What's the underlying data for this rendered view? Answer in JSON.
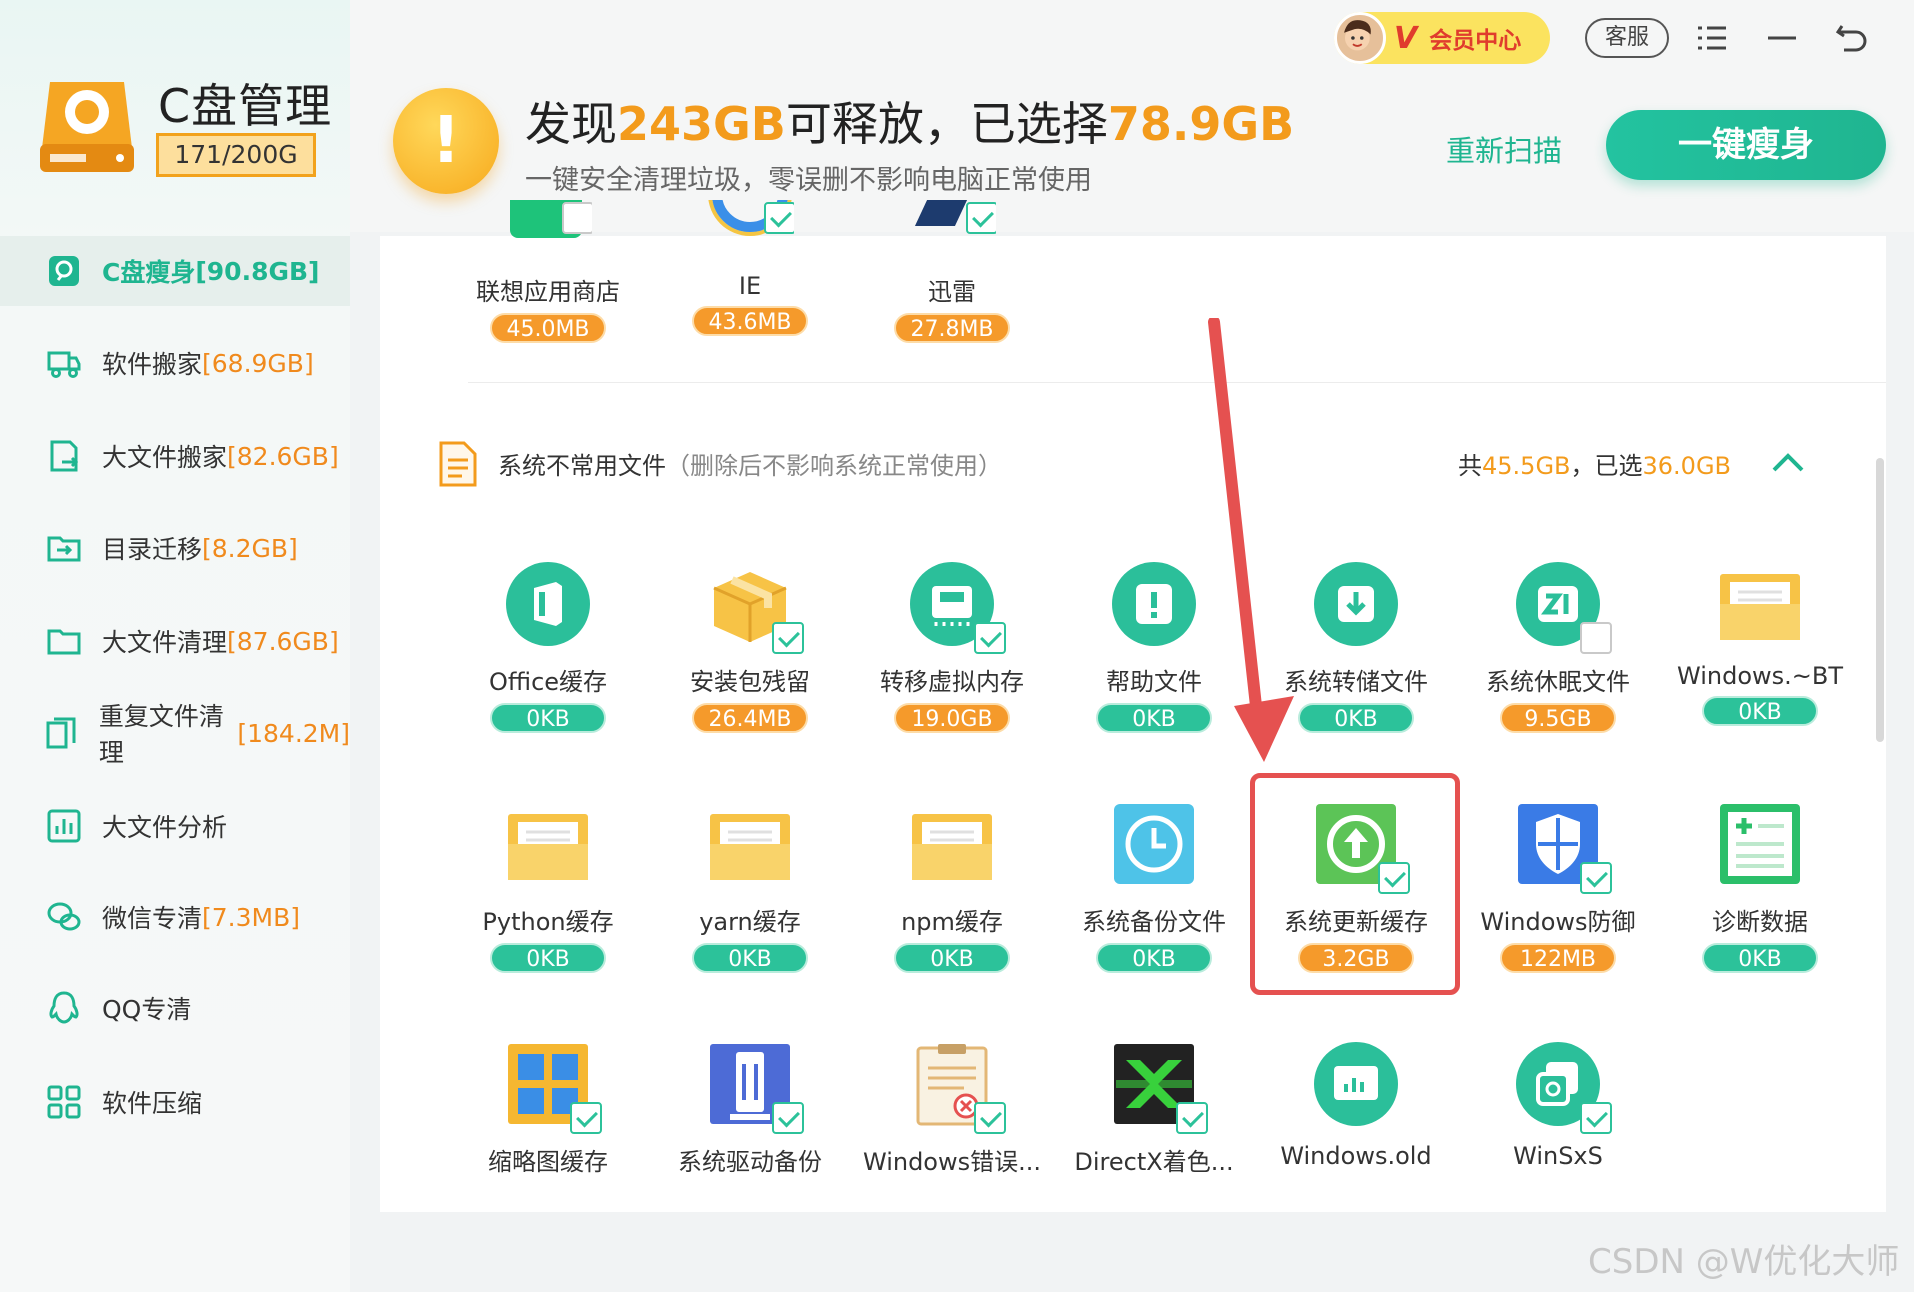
{
  "app": {
    "name": "C盘管理",
    "disk_usage": "171/200G"
  },
  "sidebar": {
    "items": [
      {
        "label": "C盘瘦身",
        "size": "[90.8GB]",
        "icon": "slim-icon",
        "active": true
      },
      {
        "label": "软件搬家",
        "size": "[68.9GB]",
        "icon": "truck-icon"
      },
      {
        "label": "大文件搬家",
        "size": "[82.6GB]",
        "icon": "file-move-icon"
      },
      {
        "label": "目录迁移",
        "size": "[8.2GB]",
        "icon": "folder-move-icon"
      },
      {
        "label": "大文件清理",
        "size": "[87.6GB]",
        "icon": "folder-icon"
      },
      {
        "label": "重复文件清理",
        "size": "[184.2M]",
        "icon": "duplicate-icon"
      },
      {
        "label": "大文件分析",
        "size": "",
        "icon": "chart-icon"
      },
      {
        "label": "微信专清",
        "size": "[7.3MB]",
        "icon": "wechat-icon"
      },
      {
        "label": "QQ专清",
        "size": "",
        "icon": "qq-icon"
      },
      {
        "label": "软件压缩",
        "size": "",
        "icon": "compress-icon"
      }
    ]
  },
  "header": {
    "headline_pre": "发现",
    "found": "243GB",
    "headline_mid": "可释放，已选择",
    "selected": "78.9GB",
    "subline": "一键安全清理垃圾，零误删不影响电脑正常使用",
    "rescan": "重新扫描",
    "slim_button": "一键瘦身",
    "vip_badge": "V",
    "vip_label": "会员中心",
    "support": "客服"
  },
  "top_row": [
    {
      "name": "联想应用商店",
      "size": "45.0MB",
      "checked": false
    },
    {
      "name": "IE",
      "size": "43.6MB",
      "checked": true
    },
    {
      "name": "迅雷",
      "size": "27.8MB",
      "checked": true
    }
  ],
  "section": {
    "title": "系统不常用文件",
    "hint": "（删除后不影响系统正常使用）",
    "total_label": "共",
    "total": "45.5GB",
    "sep": "，",
    "selected_label": "已选",
    "selected": "36.0GB"
  },
  "items": [
    {
      "name": "Office缓存",
      "size": "0KB",
      "icon": "office-icon",
      "checked": false
    },
    {
      "name": "安装包残留",
      "size": "26.4MB",
      "icon": "package-icon",
      "checked": true
    },
    {
      "name": "转移虚拟内存",
      "size": "19.0GB",
      "icon": "memory-icon",
      "checked": true
    },
    {
      "name": "帮助文件",
      "size": "0KB",
      "icon": "help-icon",
      "checked": false
    },
    {
      "name": "系统转储文件",
      "size": "0KB",
      "icon": "download-icon",
      "checked": false
    },
    {
      "name": "系统休眠文件",
      "size": "9.5GB",
      "icon": "hibernate-icon",
      "checked": false
    },
    {
      "name": "Windows.~BT",
      "size": "0KB",
      "icon": "folder-icon",
      "checked": false
    },
    {
      "name": "Python缓存",
      "size": "0KB",
      "icon": "folder-icon",
      "checked": false
    },
    {
      "name": "yarn缓存",
      "size": "0KB",
      "icon": "folder-icon",
      "checked": false
    },
    {
      "name": "npm缓存",
      "size": "0KB",
      "icon": "folder-icon",
      "checked": false
    },
    {
      "name": "系统备份文件",
      "size": "0KB",
      "icon": "backup-clock-icon",
      "checked": false
    },
    {
      "name": "系统更新缓存",
      "size": "3.2GB",
      "icon": "update-icon",
      "checked": true
    },
    {
      "name": "Windows防御",
      "size": "122MB",
      "icon": "shield-icon",
      "checked": true
    },
    {
      "name": "诊断数据",
      "size": "0KB",
      "icon": "diagnostic-icon",
      "checked": false
    },
    {
      "name": "缩略图缓存",
      "size": "",
      "icon": "thumbnail-icon",
      "checked": true
    },
    {
      "name": "系统驱动备份",
      "size": "",
      "icon": "driver-icon",
      "checked": true
    },
    {
      "name": "Windows错误...",
      "size": "",
      "icon": "error-report-icon",
      "checked": true
    },
    {
      "name": "DirectX着色...",
      "size": "",
      "icon": "directx-icon",
      "checked": true
    },
    {
      "name": "Windows.old",
      "size": "",
      "icon": "windows-old-icon",
      "checked": false
    },
    {
      "name": "WinSxS",
      "size": "",
      "icon": "winsxs-icon",
      "checked": true
    }
  ],
  "colors": {
    "accent": "#1fb590",
    "orange": "#f39b1c",
    "highlight": "#e55150"
  },
  "watermark": "CSDN @W优化大师"
}
